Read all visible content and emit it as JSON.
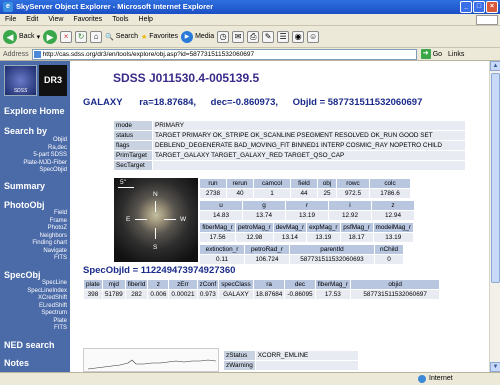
{
  "window": {
    "title": "SkyServer Object Explorer - Microsoft Internet Explorer"
  },
  "menu": [
    "File",
    "Edit",
    "View",
    "Favorites",
    "Tools",
    "Help"
  ],
  "toolbar": {
    "back": "Back",
    "search": "Search",
    "favorites": "Favorites",
    "media": "Media"
  },
  "address": {
    "label": "Address",
    "url": "http://cas.sdss.org/dr3/en/tools/explore/obj.asp?id=587731511532060697",
    "go": "Go",
    "links": "Links"
  },
  "status": {
    "zone": "Internet"
  },
  "sidebar": {
    "logo_text": "SDSS",
    "release": "DR3",
    "home": "Explore Home",
    "search_by": "Search by",
    "search_items": [
      "Objid",
      "Ra,dec",
      "5-part SDSS",
      "Plate-MJD-Fiber",
      "SpecObjid"
    ],
    "summary": "Summary",
    "photoobj": "PhotoObj",
    "photo_items": [
      "Field",
      "Frame",
      "PhotoZ",
      "Neighbors",
      "Finding chart",
      "Navigate",
      "FITS"
    ],
    "specobj": "SpecObj",
    "spec_items": [
      "SpecLine",
      "SpecLineIndex",
      "XCredShift",
      "ELredShift",
      "Spectrum",
      "Plate",
      "FITS"
    ],
    "ned": "NED search",
    "notes": "Notes"
  },
  "object": {
    "name": "SDSS J011530.4-005139.5",
    "type": "GALAXY",
    "ra": "ra=18.87684,",
    "dec": "dec=-0.860973,",
    "objid": "ObjId = 587731511532060697"
  },
  "info": [
    {
      "label": "mode",
      "value": "PRIMARY"
    },
    {
      "label": "status",
      "value": "TARGET PRIMARY OK_STRIPE OK_SCANLINE PSEGMENT RESOLVED OK_RUN GOOD SET"
    },
    {
      "label": "flags",
      "value": "DEBLEND_DEGENERATE BAD_MOVING_FIT BINNED1 INTERP COSMIC_RAY NOPETRO CHILD"
    },
    {
      "label": "PrimTarget",
      "value": "TARGET_GALAXY TARGET_GALAXY_RED TARGET_QSO_CAP"
    },
    {
      "label": "SecTarget",
      "value": ""
    }
  ],
  "image": {
    "scale": "5\"",
    "n": "N",
    "e": "E",
    "w": "W",
    "s": "S"
  },
  "t1": {
    "headers": [
      "run",
      "rerun",
      "camcol",
      "field",
      "obj",
      "rowc",
      "colc"
    ],
    "values": [
      "2738",
      "40",
      "1",
      "44",
      "25",
      "972.5",
      "1786.6"
    ]
  },
  "t2": {
    "headers": [
      "u",
      "g",
      "r",
      "i",
      "z"
    ],
    "values": [
      "14.83",
      "13.74",
      "13.19",
      "12.92",
      "12.94"
    ]
  },
  "t3": {
    "headers": [
      "fiberMag_r",
      "petroMag_r",
      "devMag_r",
      "expMag_r",
      "psfMag_r",
      "modelMag_r"
    ],
    "values": [
      "17.56",
      "12.98",
      "13.14",
      "13.19",
      "18.17",
      "13.19"
    ]
  },
  "t4": {
    "headers": [
      "extinction_r",
      "petroRad_r",
      "parentId",
      "nChild"
    ],
    "values": [
      "0.11",
      "106.724",
      "587731511532060693",
      "0"
    ]
  },
  "specobj": {
    "title": "SpecObjId = 112249473974927360",
    "headers": [
      "plate",
      "mjd",
      "fiberId",
      "z",
      "zErr",
      "zConf",
      "specClass",
      "ra",
      "dec",
      "fiberMag_r",
      "objid"
    ],
    "values": [
      "398",
      "51789",
      "282",
      "0.006",
      "0.00021",
      "0.973",
      "GALAXY",
      "18.87684",
      "-0.86095",
      "17.53",
      "587731511532060697"
    ]
  },
  "zinfo": [
    {
      "label": "zStatus",
      "value": "XCORR_EMLINE"
    },
    {
      "label": "zWarning",
      "value": ""
    }
  ]
}
